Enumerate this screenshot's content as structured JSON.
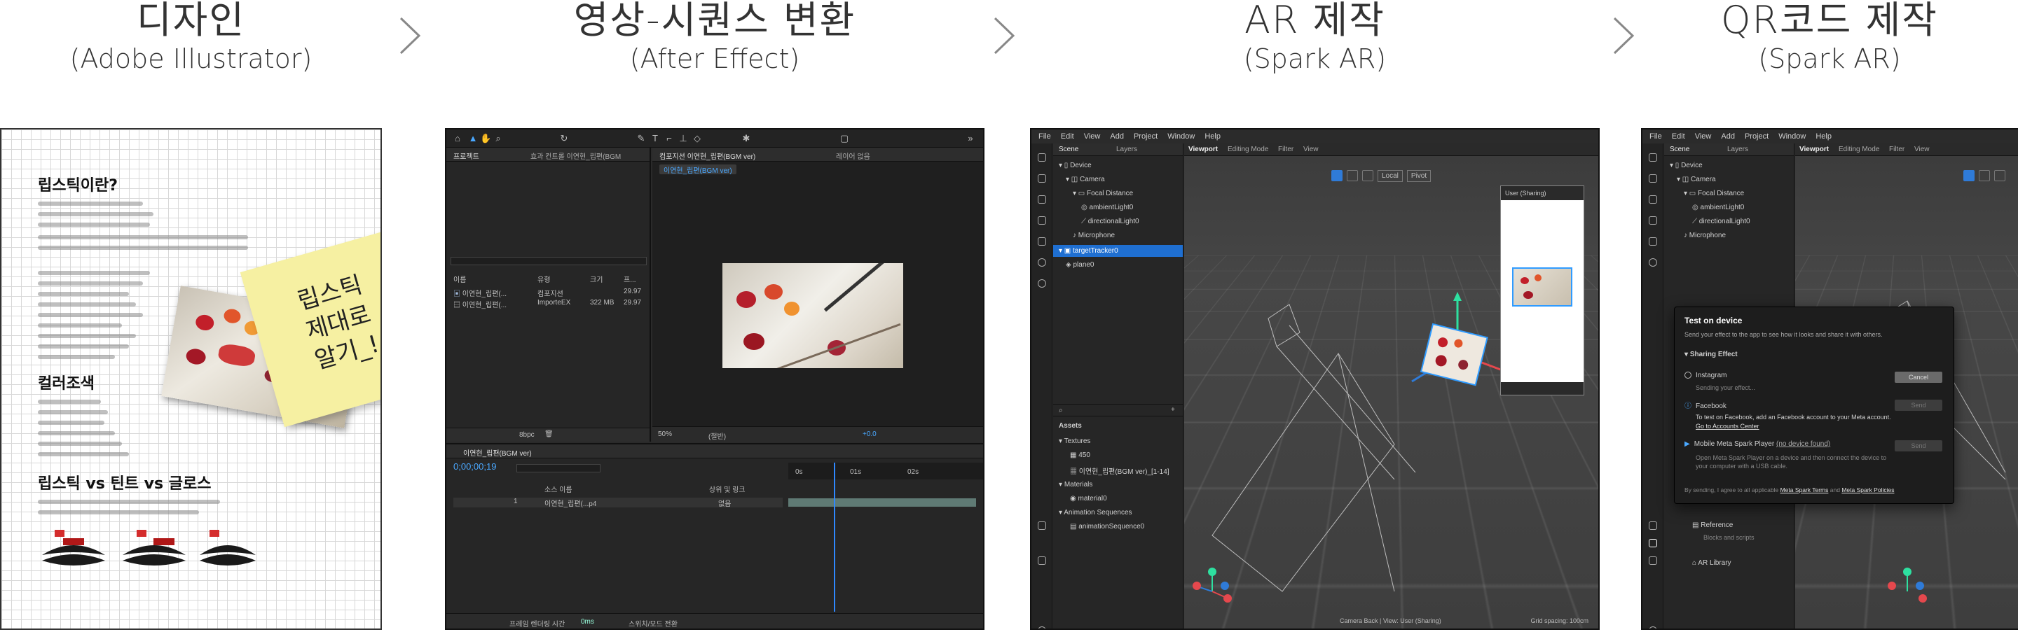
{
  "steps": [
    {
      "title": "디자인",
      "subtitle": "(Adobe Illustrator)"
    },
    {
      "title": "영상-시퀀스 변환",
      "subtitle": "(After Effect)"
    },
    {
      "title": "AR 제작",
      "subtitle": "(Spark AR)"
    },
    {
      "title": "QR코드 제작",
      "subtitle": "(Spark AR)"
    }
  ],
  "design": {
    "section1": "립스틱이란?",
    "section2": "컬러조색",
    "section3": "립스틱 vs 틴트 vs 글로스",
    "sticky_note": "립스틱\n제대로\n알기_!"
  },
  "ae": {
    "project_tab": "프로젝트",
    "effect_tab": "효과 컨트롤 이연현_립편(BGM",
    "comp_tab": "컴포지션 이연현_립편(BGM ver)",
    "flow_tab": "레이어 없음",
    "comp_title": "이연현_립편(BGM ver)",
    "col_name": "이름",
    "col_type": "유형",
    "col_size": "크기",
    "col_fps": "프...",
    "items": [
      {
        "name": "이연현_립편(...",
        "type": "컴포지션",
        "fps": "29.97"
      },
      {
        "name": "이연현_립편(...",
        "type": "ImporteEX",
        "size": "322 MB",
        "fps": "29.97"
      }
    ],
    "zoom": "50%",
    "quality": "(절반)",
    "timecode": "0;00;00;19",
    "timeline_tab": "이연현_립편(BGM ver)",
    "layer_col": "소스 이름",
    "parent_col": "상위 및 링크",
    "layer_name": "이연현_립편(...p4",
    "parent_value": "없음",
    "bottom_label": "프레임 렌더링 시간",
    "render_time": "0ms",
    "toggle_label": "스위치/모드 전환",
    "fps_label": "8bpc",
    "ruler": [
      "0s",
      "01s",
      "02s"
    ]
  },
  "spark1": {
    "menu": [
      "File",
      "Edit",
      "View",
      "Add",
      "Project",
      "Window",
      "Help"
    ],
    "scene_tab": "Scene",
    "layers_tab": "Layers",
    "viewport_tab": "Viewport",
    "editing_mode": "Editing Mode",
    "filter": "Filter",
    "view": "View",
    "tree": [
      "Device",
      "Camera",
      "Focal Distance",
      "ambientLight0",
      "directionalLight0",
      "Microphone",
      "targetTracker0",
      "plane0"
    ],
    "assets_label": "Assets",
    "assets": [
      "Textures",
      "450",
      "이연현_립편(BGM ver)_[1-14]",
      "Materials",
      "material0",
      "Animation Sequences",
      "animationSequence0"
    ],
    "local_btn": "Local",
    "pivot_btn": "Pivot",
    "sim_label": "User (Sharing)",
    "status": "Camera Back | View: User (Sharing)",
    "grid_spacing": "Grid spacing: 100cm"
  },
  "spark2": {
    "dialog_title": "Test on device",
    "dialog_sub": "Send your effect to the app to see how it looks and share it with others.",
    "sharing": "Sharing Effect",
    "instagram": "Instagram",
    "sending": "Sending your effect...",
    "cancel": "Cancel",
    "facebook": "Facebook",
    "send": "Send",
    "fb_note": "To test on Facebook, add an Facebook account to your Meta account.",
    "fb_link": "Go to Accounts Center",
    "player": "Mobile Meta Spark Player",
    "no_device": "(no device found)",
    "player_note1": "Open Meta Spark Player on a device and then connect the device to",
    "player_note2": "your computer with a USB cable.",
    "terms_pre": "By sending, I agree to all applicable",
    "terms": "Meta Spark Terms",
    "and": "and",
    "policies": "Meta Spark Policies",
    "reference": "Reference",
    "reference_sub": "Blocks and scripts",
    "ar_library": "AR Library"
  }
}
